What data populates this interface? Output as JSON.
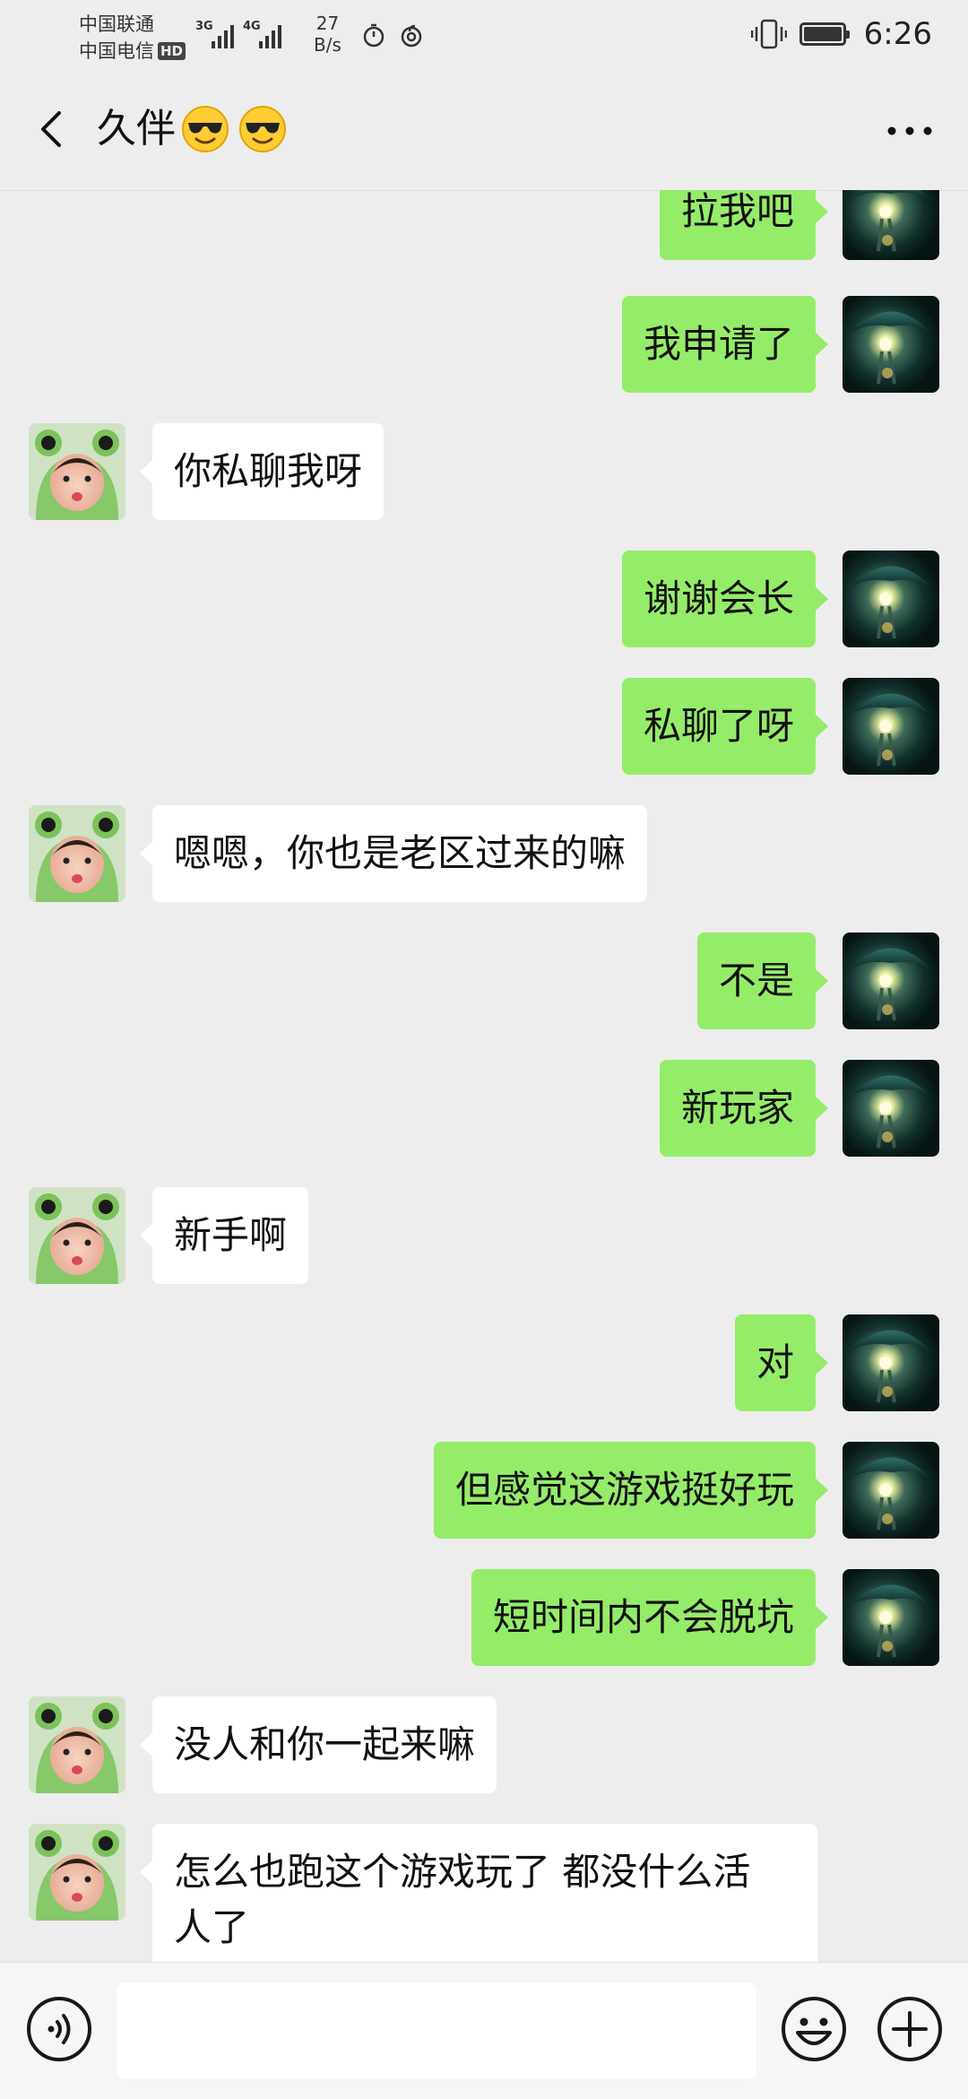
{
  "status_bar": {
    "carrier_1": "中国联通",
    "carrier_2": "中国电信",
    "hd_badge": "HD",
    "network_1": "3G",
    "network_2": "4G",
    "speed_value": "27",
    "speed_unit": "B/s",
    "time": "6:26"
  },
  "header": {
    "title": "久伴",
    "title_emojis": [
      "smiling-face-with-sunglasses",
      "smiling-face-with-sunglasses"
    ],
    "back_icon": "chevron-left-icon",
    "more_icon": "more-dots-icon"
  },
  "messages": [
    {
      "side": "right",
      "text": "拉我吧",
      "sender": "me"
    },
    {
      "side": "right",
      "text": "我申请了",
      "sender": "me"
    },
    {
      "side": "left",
      "text": "你私聊我呀",
      "sender": "contact"
    },
    {
      "side": "right",
      "text": "谢谢会长",
      "sender": "me"
    },
    {
      "side": "right",
      "text": "私聊了呀",
      "sender": "me"
    },
    {
      "side": "left",
      "text": "嗯嗯，你也是老区过来的嘛",
      "sender": "contact"
    },
    {
      "side": "right",
      "text": "不是",
      "sender": "me"
    },
    {
      "side": "right",
      "text": "新玩家",
      "sender": "me"
    },
    {
      "side": "left",
      "text": "新手啊",
      "sender": "contact"
    },
    {
      "side": "right",
      "text": "对",
      "sender": "me"
    },
    {
      "side": "right",
      "text": "但感觉这游戏挺好玩",
      "sender": "me"
    },
    {
      "side": "right",
      "text": "短时间内不会脱坑",
      "sender": "me"
    },
    {
      "side": "left",
      "text": "没人和你一起来嘛",
      "sender": "contact"
    },
    {
      "side": "left",
      "text": "怎么也跑这个游戏玩了 都没什么活\n人了",
      "sender": "contact"
    }
  ],
  "input_bar": {
    "voice_icon": "voice-icon",
    "text_value": "",
    "emoji_icon": "emoji-icon",
    "plus_icon": "plus-icon"
  },
  "colors": {
    "background": "#ededed",
    "my_bubble": "#95ec69",
    "their_bubble": "#ffffff"
  }
}
